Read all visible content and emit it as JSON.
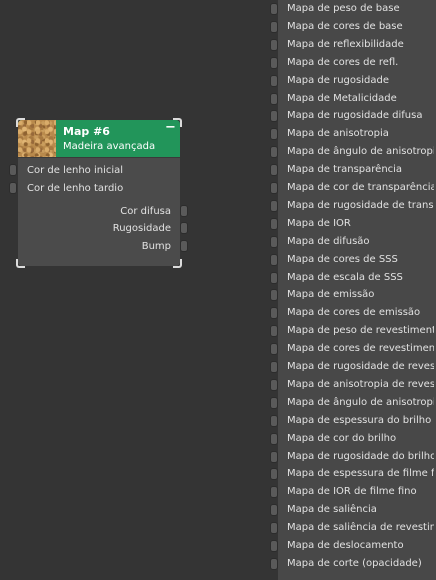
{
  "node": {
    "title": "Map #6",
    "subtitle": "Madeira avançada",
    "collapse": "−",
    "thumbnail": "wood-texture",
    "header_color": "#22955a",
    "inputs": [
      "Cor de lenho inicial",
      "Cor de lenho tardio"
    ],
    "outputs": [
      "Cor difusa",
      "Rugosidade",
      "Bump"
    ]
  },
  "map_list": {
    "items": [
      "Mapa de peso de base",
      "Mapa de cores de base",
      "Mapa de reflexibilidade",
      "Mapa de cores de refl.",
      "Mapa de rugosidade",
      "Mapa de Metalicidade",
      "Mapa de rugosidade difusa",
      "Mapa de anisotropia",
      "Mapa de ângulo de anisotropia",
      "Mapa de transparência",
      "Mapa de cor de transparência",
      "Mapa de rugosidade de transparência",
      "Mapa de IOR",
      "Mapa de difusão",
      "Mapa de cores de SSS",
      "Mapa de escala de SSS",
      "Mapa de emissão",
      "Mapa de cores de emissão",
      "Mapa de peso de revestimento",
      "Mapa de cores de revestimento",
      "Mapa de rugosidade de revestimento",
      "Mapa de anisotropia de revestimento",
      "Mapa de ângulo de anisotropia",
      "Mapa de espessura do brilho",
      "Mapa de cor do brilho",
      "Mapa de rugosidade do brilho",
      "Mapa de espessura de filme fino",
      "Mapa de IOR de filme fino",
      "Mapa de saliência",
      "Mapa de saliência de revestimento",
      "Mapa de deslocamento",
      "Mapa de corte (opacidade)"
    ]
  }
}
